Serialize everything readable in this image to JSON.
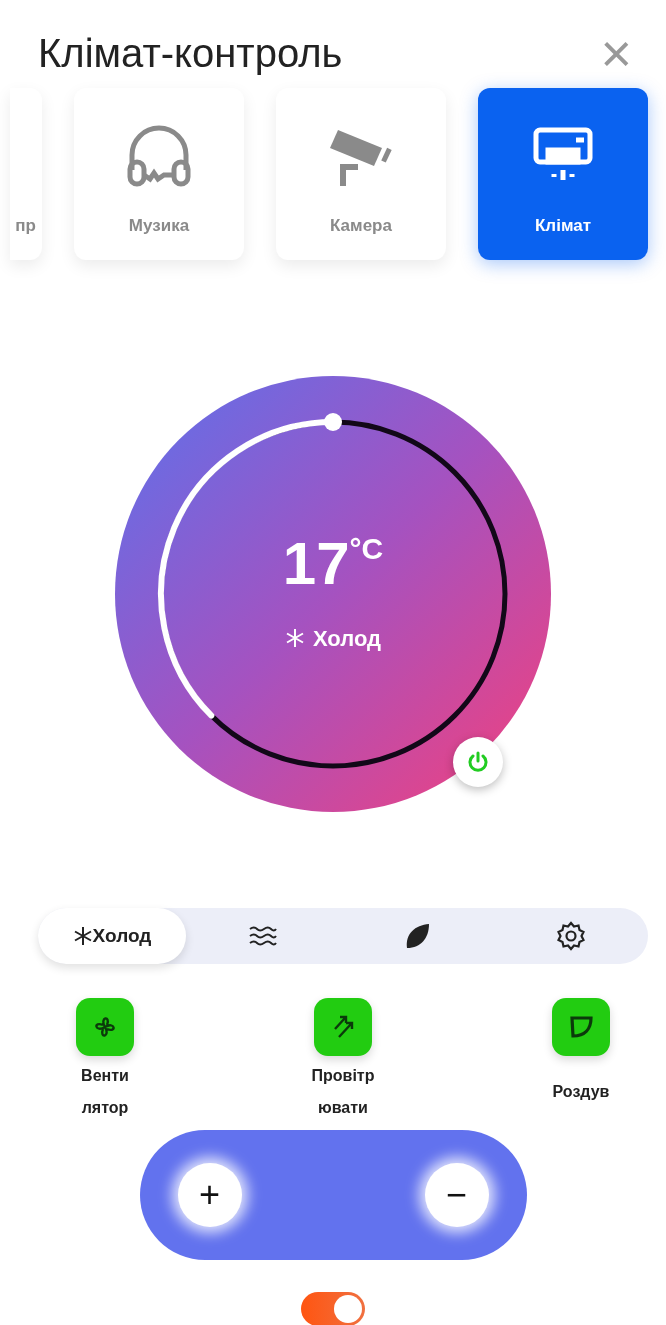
{
  "header": {
    "title": "Клімат-контроль",
    "close": "×"
  },
  "tabs": [
    {
      "label": "пр",
      "clipped": true,
      "selected": false
    },
    {
      "label": "Музика",
      "kind": "headphones",
      "clipped": false,
      "selected": false
    },
    {
      "label": "Камера",
      "kind": "camera",
      "clipped": false,
      "selected": false
    },
    {
      "label": "Клімат",
      "kind": "ac",
      "clipped": false,
      "selected": true
    }
  ],
  "dial": {
    "temperature": "17",
    "unit": "°C",
    "mode_label": "Холод",
    "power_on": true
  },
  "modes": [
    {
      "kind": "cold",
      "label": "Холод",
      "selected": true
    },
    {
      "kind": "waves",
      "selected": false
    },
    {
      "kind": "leaf",
      "selected": false
    },
    {
      "kind": "gear",
      "selected": false
    }
  ],
  "features": [
    {
      "kind": "fan",
      "label_lines": [
        "Венти",
        "лятор"
      ]
    },
    {
      "kind": "air",
      "label_lines": [
        "Провітр",
        "ювати"
      ]
    },
    {
      "kind": "blow",
      "label_lines": [
        "Роздув"
      ]
    }
  ],
  "stepper": {
    "plus": "+",
    "minus": "−"
  },
  "toggle": {
    "on": true
  }
}
